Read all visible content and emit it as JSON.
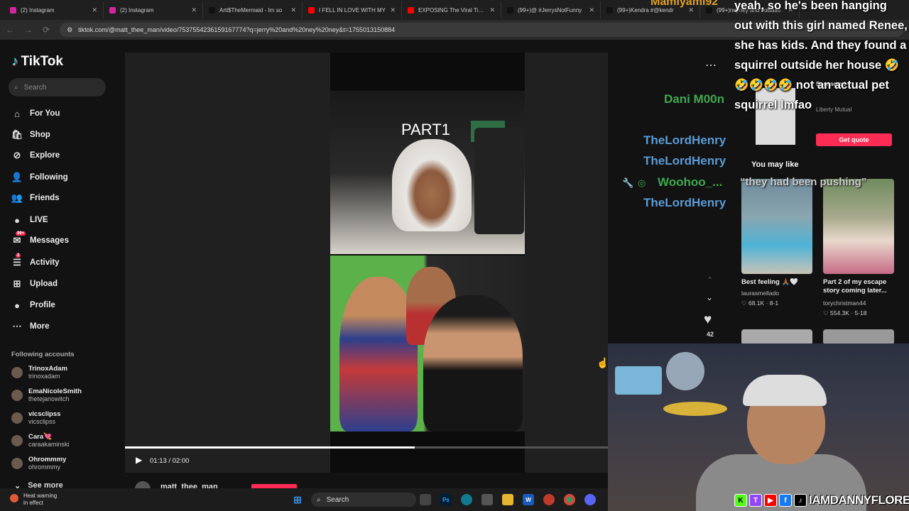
{
  "tabs": [
    {
      "label": "(2) Instagram",
      "color": "#d6249f"
    },
    {
      "label": "(2) Instagram",
      "color": "#d6249f"
    },
    {
      "label": "Arti$TheMermaid - Im so",
      "color": "#111111"
    },
    {
      "label": "I FELL IN LOVE WITH MY",
      "color": "#ff0000"
    },
    {
      "label": "EXPOSING The Viral Tiktok",
      "color": "#ff0000"
    },
    {
      "label": "(99+)@ #JerrysNotFunny",
      "color": "#111111"
    },
    {
      "label": "(99+)Kendra #@kendr",
      "color": "#111111"
    },
    {
      "label": "(99+)neyney and bolsaso",
      "color": "#111111"
    }
  ],
  "address": {
    "url": "tiktok.com/@matt_thee_man/video/7537554236159167774?q=jerry%20and%20ney%20ney&t=1755013150884"
  },
  "brand": {
    "name": "TikTok"
  },
  "search": {
    "placeholder": "Search"
  },
  "nav": [
    {
      "label": "For You",
      "icon": "home-icon"
    },
    {
      "label": "Shop",
      "icon": "shop-icon"
    },
    {
      "label": "Explore",
      "icon": "explore-icon"
    },
    {
      "label": "Following",
      "icon": "following-icon"
    },
    {
      "label": "Friends",
      "icon": "friends-icon"
    },
    {
      "label": "LIVE",
      "icon": "live-icon"
    },
    {
      "label": "Messages",
      "icon": "messages-icon",
      "badge": "99+"
    },
    {
      "label": "Activity",
      "icon": "activity-icon",
      "badge": "2"
    },
    {
      "label": "Upload",
      "icon": "upload-icon"
    },
    {
      "label": "Profile",
      "icon": "profile-icon"
    },
    {
      "label": "More",
      "icon": "more-icon"
    }
  ],
  "following_accounts": {
    "heading": "Following accounts",
    "accounts": [
      {
        "name": "TrinoxAdam",
        "handle": "trinoxadam"
      },
      {
        "name": "EmaNicoleSmith",
        "handle": "thetejanowitch"
      },
      {
        "name": "vicsclipss",
        "handle": "vicsclipss"
      },
      {
        "name": "Cara💘",
        "handle": "caraakaminski"
      },
      {
        "name": "Ohrommmy",
        "handle": "ohrommmy"
      }
    ],
    "see_more": "See more"
  },
  "video": {
    "overlay_text": "PART1",
    "time": "01:13 / 02:00",
    "progress": 0.6,
    "author": "matt_thee_man",
    "likes": "42"
  },
  "stream_chat": [
    {
      "name": "Dani M00n",
      "color": "#3fa94f"
    },
    {
      "name": "TheLordHenry",
      "color": "#5b9bd5"
    },
    {
      "name": "TheLordHenry",
      "color": "#5b9bd5"
    },
    {
      "name": "Woohoo_...",
      "color": "#3fa94f"
    },
    {
      "name": "TheLordHenry",
      "color": "#5b9bd5"
    }
  ],
  "stream_caption": {
    "user": "Mamiyami92",
    "text": "yeah, so he's been hanging out with this girl named Renee, she has kids. And they found a squirrel outside her house 🤣🤣🤣🤣🤣 not an actual pet squirrel lmfao"
  },
  "ad": {
    "sponsored": "Sponsored",
    "advertiser": "Liberty Mutual",
    "cta": "Get quote"
  },
  "you_may_like": {
    "heading": "You may like",
    "quote_overlay": "“they had been pushing”",
    "cards": [
      {
        "title": "Best feeling 🙏🏾🤍",
        "user": "laurasmellado",
        "likes": "68.1K",
        "date": "8-1"
      },
      {
        "title": "Part 2 of my escape story coming later...",
        "user": "torychristman44",
        "likes": "554.3K",
        "date": "5-18"
      }
    ]
  },
  "streamer": {
    "handle": "IAMDANNYFLORES"
  },
  "taskbar": {
    "weather_title": "Heat warning",
    "weather_sub": "in effect",
    "search_label": "Search"
  }
}
